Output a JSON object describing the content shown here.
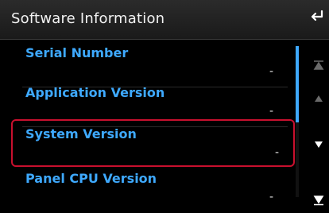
{
  "header": {
    "title": "Software Information",
    "back_icon": "back-arrow-icon"
  },
  "items": [
    {
      "label": "Serial Number",
      "value": "-"
    },
    {
      "label": "Application Version",
      "value": "-"
    },
    {
      "label": "System Version",
      "value": "-"
    },
    {
      "label": "Panel CPU Version",
      "value": "-"
    }
  ],
  "scroll": {
    "top_icon": "scroll-top-icon",
    "up_icon": "scroll-up-icon",
    "down_icon": "scroll-down-icon",
    "bottom_icon": "scroll-bottom-icon",
    "position_fraction": 0.0,
    "visible_fraction": 0.5
  },
  "colors": {
    "accent": "#3ea9ff",
    "selection": "#c8102e",
    "header_bg": "#222222",
    "background": "#000000"
  }
}
